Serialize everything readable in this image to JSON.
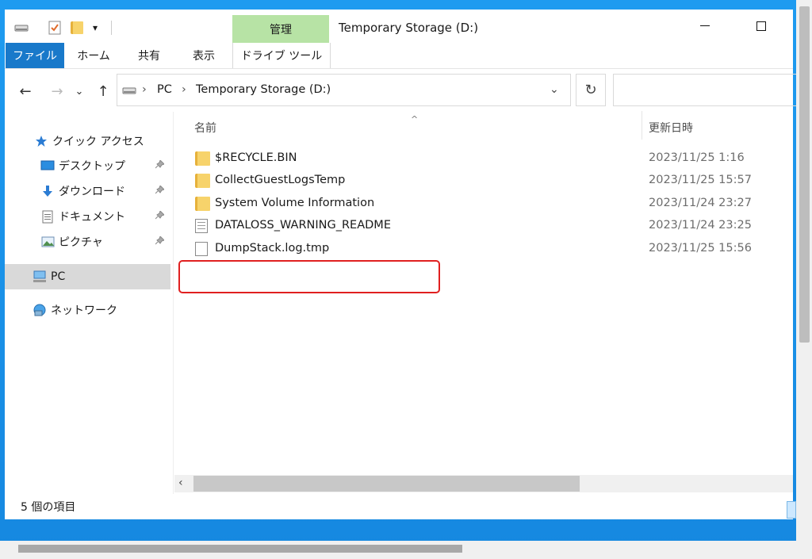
{
  "titlebar": {
    "quick_access": [
      "drive-icon",
      "checkbox-icon",
      "folder-icon",
      "chevron-down-icon"
    ],
    "manage_tab": "管理",
    "window_title": "Temporary Storage (D:)",
    "minimize_glyph": "—",
    "maximize_glyph": "☐"
  },
  "ribbon": {
    "tabs": [
      "ファイル",
      "ホーム",
      "共有",
      "表示",
      "ドライブ ツール"
    ]
  },
  "navbar": {
    "back": "←",
    "forward": "→",
    "recent": "⌄",
    "up": "↑",
    "breadcrumb": [
      "PC",
      "Temporary Storage (D:)"
    ],
    "separator": "›",
    "dropdown": "⌄",
    "refresh": "↻",
    "search_placeholder": ""
  },
  "sidebar": {
    "quick_access_label": "クイック アクセス",
    "items": [
      {
        "label": "デスクトップ",
        "icon": "desktop-icon",
        "pinned": true
      },
      {
        "label": "ダウンロード",
        "icon": "download-icon",
        "pinned": true
      },
      {
        "label": "ドキュメント",
        "icon": "document-icon",
        "pinned": true
      },
      {
        "label": "ピクチャ",
        "icon": "picture-icon",
        "pinned": true
      }
    ],
    "pc_label": "PC",
    "network_label": "ネットワーク",
    "pin_glyph": "📌"
  },
  "content": {
    "col_name": "名前",
    "col_date": "更新日時",
    "sort_glyph": "^",
    "files": [
      {
        "name": "$RECYCLE.BIN",
        "date": "2023/11/25 1:16",
        "type": "folder"
      },
      {
        "name": "CollectGuestLogsTemp",
        "date": "2023/11/25 15:57",
        "type": "folder"
      },
      {
        "name": "System Volume Information",
        "date": "2023/11/24 23:27",
        "type": "folder"
      },
      {
        "name": "DATALOSS_WARNING_README",
        "date": "2023/11/24 23:25",
        "type": "text"
      },
      {
        "name": "DumpStack.log.tmp",
        "date": "2023/11/25 15:56",
        "type": "file"
      }
    ]
  },
  "statusbar": {
    "item_count": "5 個の項目"
  },
  "scroll_left": "‹"
}
